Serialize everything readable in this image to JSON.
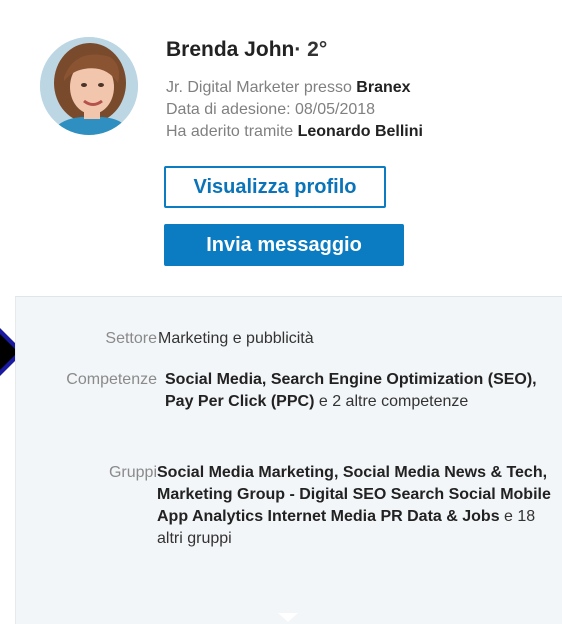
{
  "profile": {
    "name": "Brenda John",
    "degree": "· 2°",
    "role_prefix": "Jr. Digital Marketer presso ",
    "company": "Branex",
    "joined_text": "Data di adesione: 08/05/2018",
    "joined_via_prefix": "Ha aderito tramite ",
    "joined_via_name": "Leonardo Bellini"
  },
  "actions": {
    "view_profile": "Visualizza profilo",
    "send_message": "Invia messaggio"
  },
  "details": {
    "sector_label": "Settore",
    "sector_value": "Marketing e pubblicità",
    "skills_label": "Competenze",
    "skills_bold": "Social Media, Search Engine Optimization (SEO), Pay Per Click (PPC)",
    "skills_rest": " e 2 altre competenze",
    "groups_label": "Gruppi",
    "groups_bold": "Social Media Marketing, Social Media News & Tech, Marketing Group - Digital SEO Search Social Mobile App Analytics Internet Media PR Data & Jobs",
    "groups_rest": " e 18 altri gruppi"
  },
  "colors": {
    "accent": "#0b7cc1",
    "panel_bg": "#f3f6f8",
    "marker": "#1a1aa0"
  }
}
